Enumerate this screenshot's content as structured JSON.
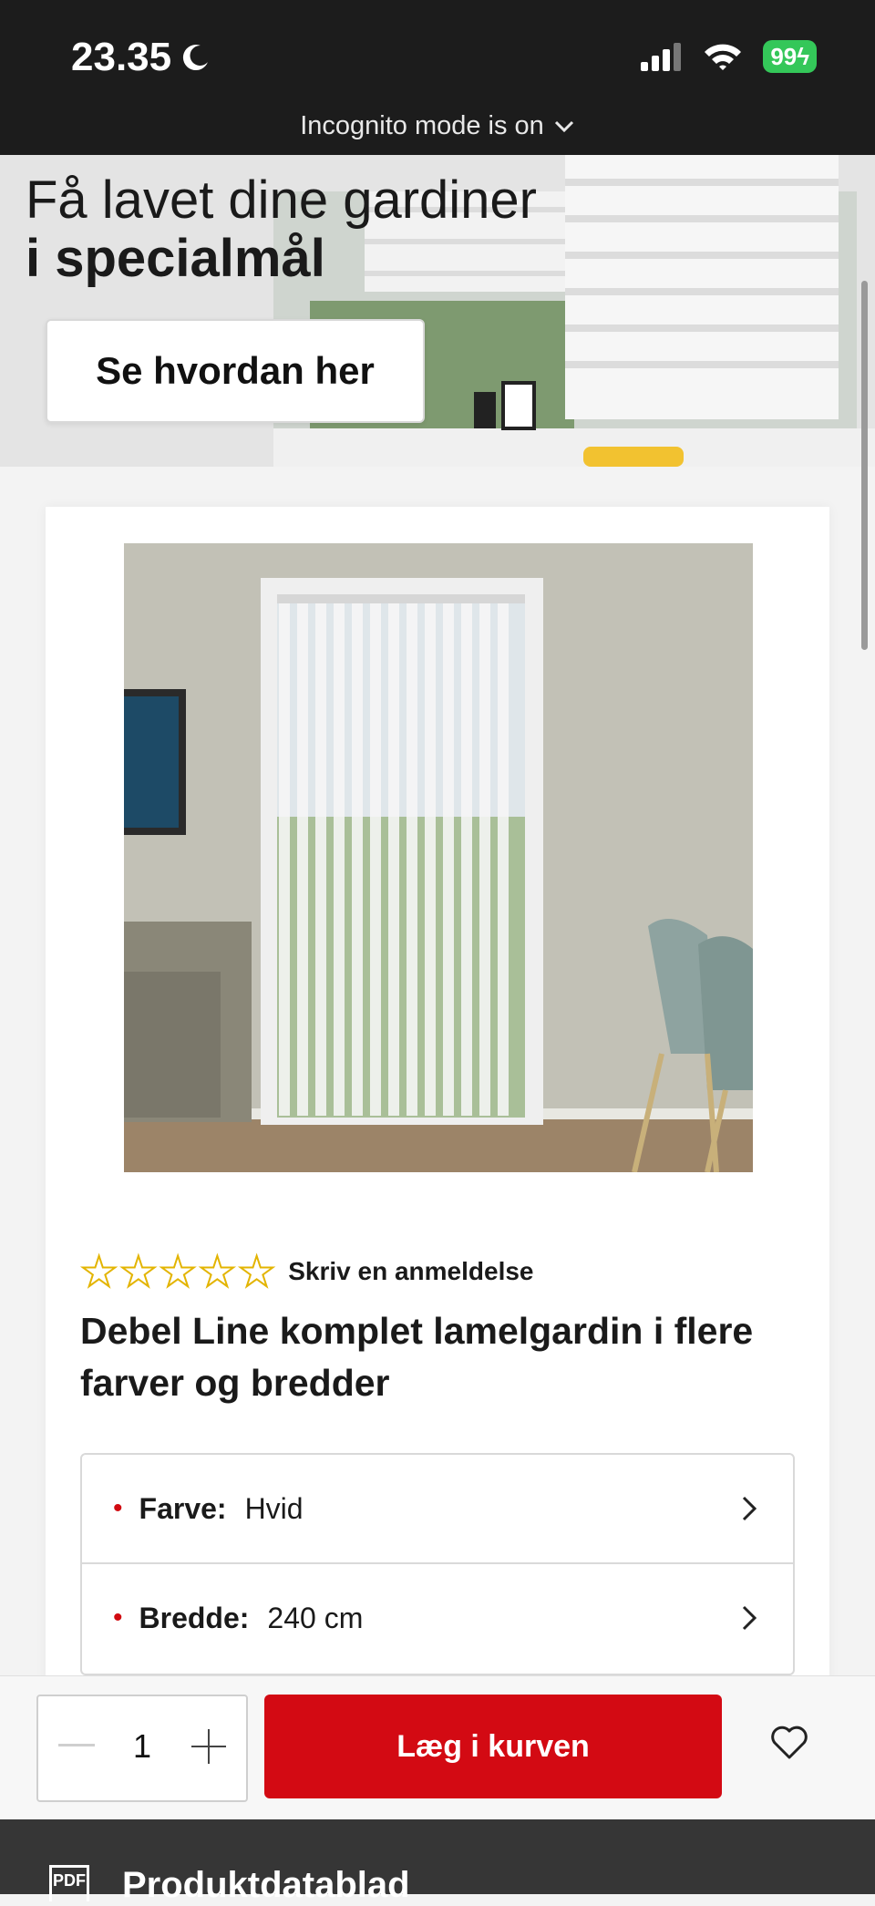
{
  "status_bar": {
    "time": "23.35",
    "battery": "99",
    "incognito": "Incognito mode is on"
  },
  "banner": {
    "title_line1": "Få lavet dine gardiner",
    "title_line2": "i specialmål",
    "button": "Se hvordan her"
  },
  "product": {
    "rating_stars": 0,
    "review_link": "Skriv en anmeldelse",
    "title": "Debel Line komplet lamelgardin i flere farver og bredder",
    "options": [
      {
        "label": "Farve:",
        "value": "Hvid"
      },
      {
        "label": "Bredde:",
        "value": "240 cm"
      }
    ]
  },
  "cart_bar": {
    "quantity": "1",
    "add_button": "Læg i kurven"
  },
  "footer": {
    "pdf_icon_text": "PDF",
    "label": "Produktdatablad"
  },
  "colors": {
    "accent": "#d30a13",
    "star_outline": "#e3b400"
  }
}
